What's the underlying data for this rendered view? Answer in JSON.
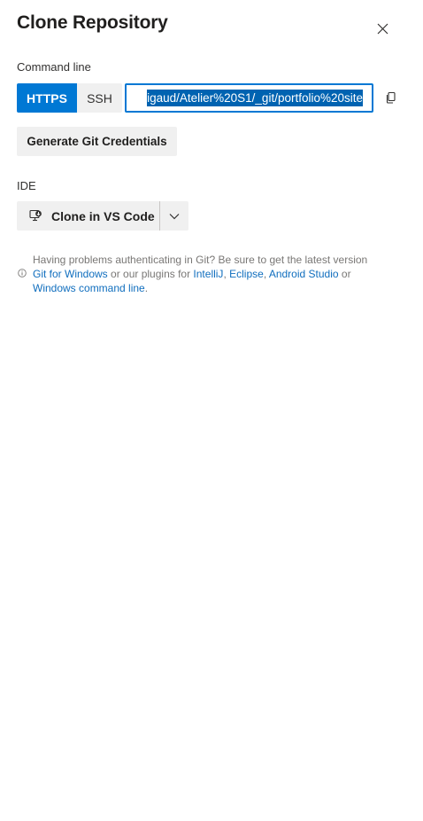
{
  "panel": {
    "title": "Clone Repository"
  },
  "command_line": {
    "label": "Command line",
    "protocols": {
      "https_label": "HTTPS",
      "ssh_label": "SSH",
      "selected": "HTTPS"
    },
    "url_visible_value": "igaud/Atelier%20S1/_git/portfolio%20site",
    "copy_icon": "copy-icon"
  },
  "credentials": {
    "button_label": "Generate Git Credentials"
  },
  "ide": {
    "label": "IDE",
    "clone_button_label": "Clone in VS Code",
    "clone_icon": "vscode-clone-icon",
    "dropdown_icon": "chevron-down-icon"
  },
  "help": {
    "intro": "Having problems authenticating in Git? Be sure to get the latest version",
    "git_for_windows": "Git for Windows",
    "middle": "or our plugins for",
    "intellij": "IntelliJ",
    "comma1": ",",
    "eclipse": "Eclipse",
    "comma2": ",",
    "android_studio": "Android Studio",
    "or": "or",
    "windows_command_line": "Windows command line",
    "period": "."
  },
  "colors": {
    "accent": "#0078d4",
    "selection": "#0063b1",
    "button_bg": "#f0f0f0",
    "link": "#106ebe",
    "muted_text": "#797775"
  }
}
